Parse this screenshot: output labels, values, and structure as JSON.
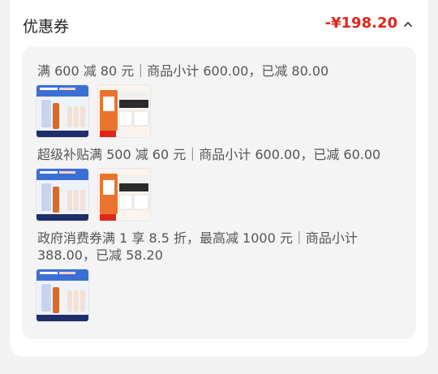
{
  "header": {
    "title": "优惠券",
    "amount": "-¥198.20"
  },
  "coupons": [
    {
      "text": "满 600 减 80 元｜商品小计 600.00，已减 80.00"
    },
    {
      "text": "超级补贴满 500 减 60 元｜商品小计 600.00，已减 60.00"
    },
    {
      "text_line1": "政府消费券满 1 享 8.5 折，最高减 1000 元｜商品小计",
      "text_line2": "388.00，已减 58.20"
    }
  ],
  "icons": {
    "chevron": "chevron-up-icon"
  },
  "colors": {
    "accent": "#e1251b",
    "panel_bg": "#f4f4f4"
  }
}
